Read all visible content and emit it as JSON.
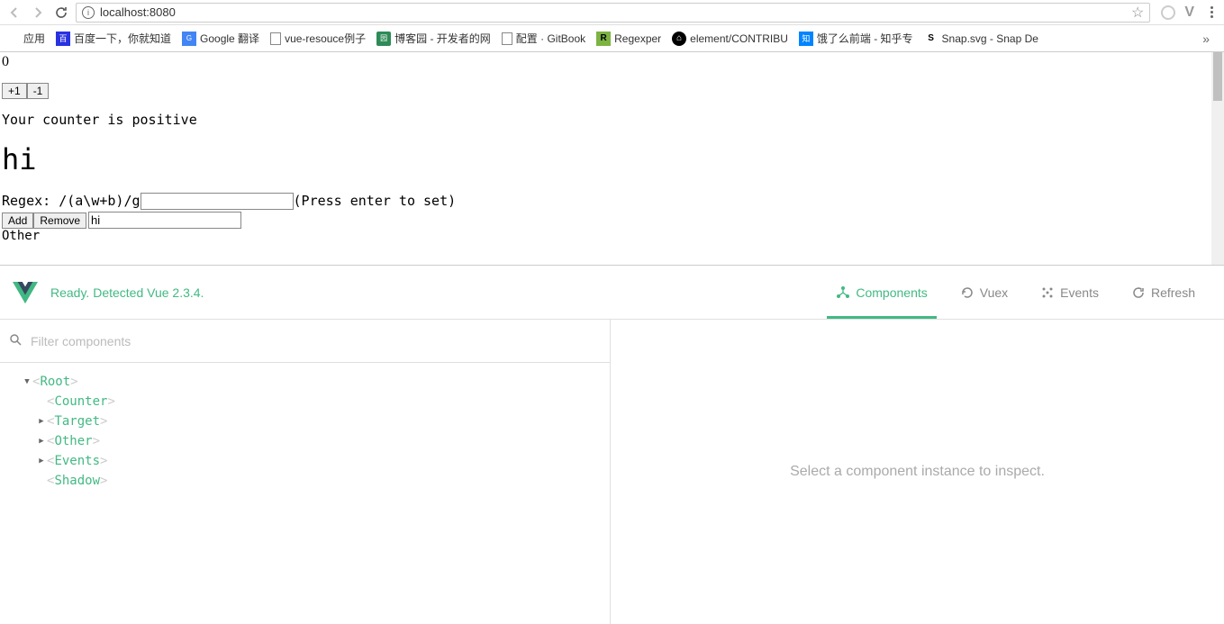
{
  "browser": {
    "url": "localhost:8080",
    "bookmarks": [
      {
        "label": "应用",
        "type": "apps"
      },
      {
        "label": "百度一下，你就知道",
        "type": "baidu"
      },
      {
        "label": "Google 翻译",
        "type": "google"
      },
      {
        "label": "vue-resouce例子",
        "type": "file"
      },
      {
        "label": "博客园 - 开发者的网",
        "type": "cnblogs"
      },
      {
        "label": "配置 · GitBook",
        "type": "file"
      },
      {
        "label": "Regexper",
        "type": "regex"
      },
      {
        "label": "element/CONTRIBU",
        "type": "github"
      },
      {
        "label": "饿了么前端 - 知乎专",
        "type": "zhihu"
      },
      {
        "label": "Snap.svg - Snap De",
        "type": "snap"
      }
    ],
    "overflow": "»"
  },
  "page": {
    "counter_value": "0",
    "btn_inc": "+1",
    "btn_dec": "-1",
    "counter_message": "Your counter is positive",
    "heading": "hi",
    "regex_label": "Regex: /(a\\w+b)/g",
    "regex_hint": "(Press enter to set)",
    "btn_add": "Add",
    "btn_remove": "Remove",
    "input_value": "hi",
    "other_text": "Other"
  },
  "devtools": {
    "ready_text": "Ready. Detected Vue 2.3.4.",
    "tabs": {
      "components": "Components",
      "vuex": "Vuex",
      "events": "Events",
      "refresh": "Refresh"
    },
    "filter_placeholder": "Filter components",
    "tree": [
      {
        "label": "Root",
        "indent": 1,
        "arrow": "down"
      },
      {
        "label": "Counter",
        "indent": 2,
        "arrow": "none"
      },
      {
        "label": "Target",
        "indent": 2,
        "arrow": "right"
      },
      {
        "label": "Other",
        "indent": 2,
        "arrow": "right"
      },
      {
        "label": "Events",
        "indent": 2,
        "arrow": "right"
      },
      {
        "label": "Shadow",
        "indent": 2,
        "arrow": "none"
      }
    ],
    "inspect_placeholder": "Select a component instance to inspect."
  }
}
